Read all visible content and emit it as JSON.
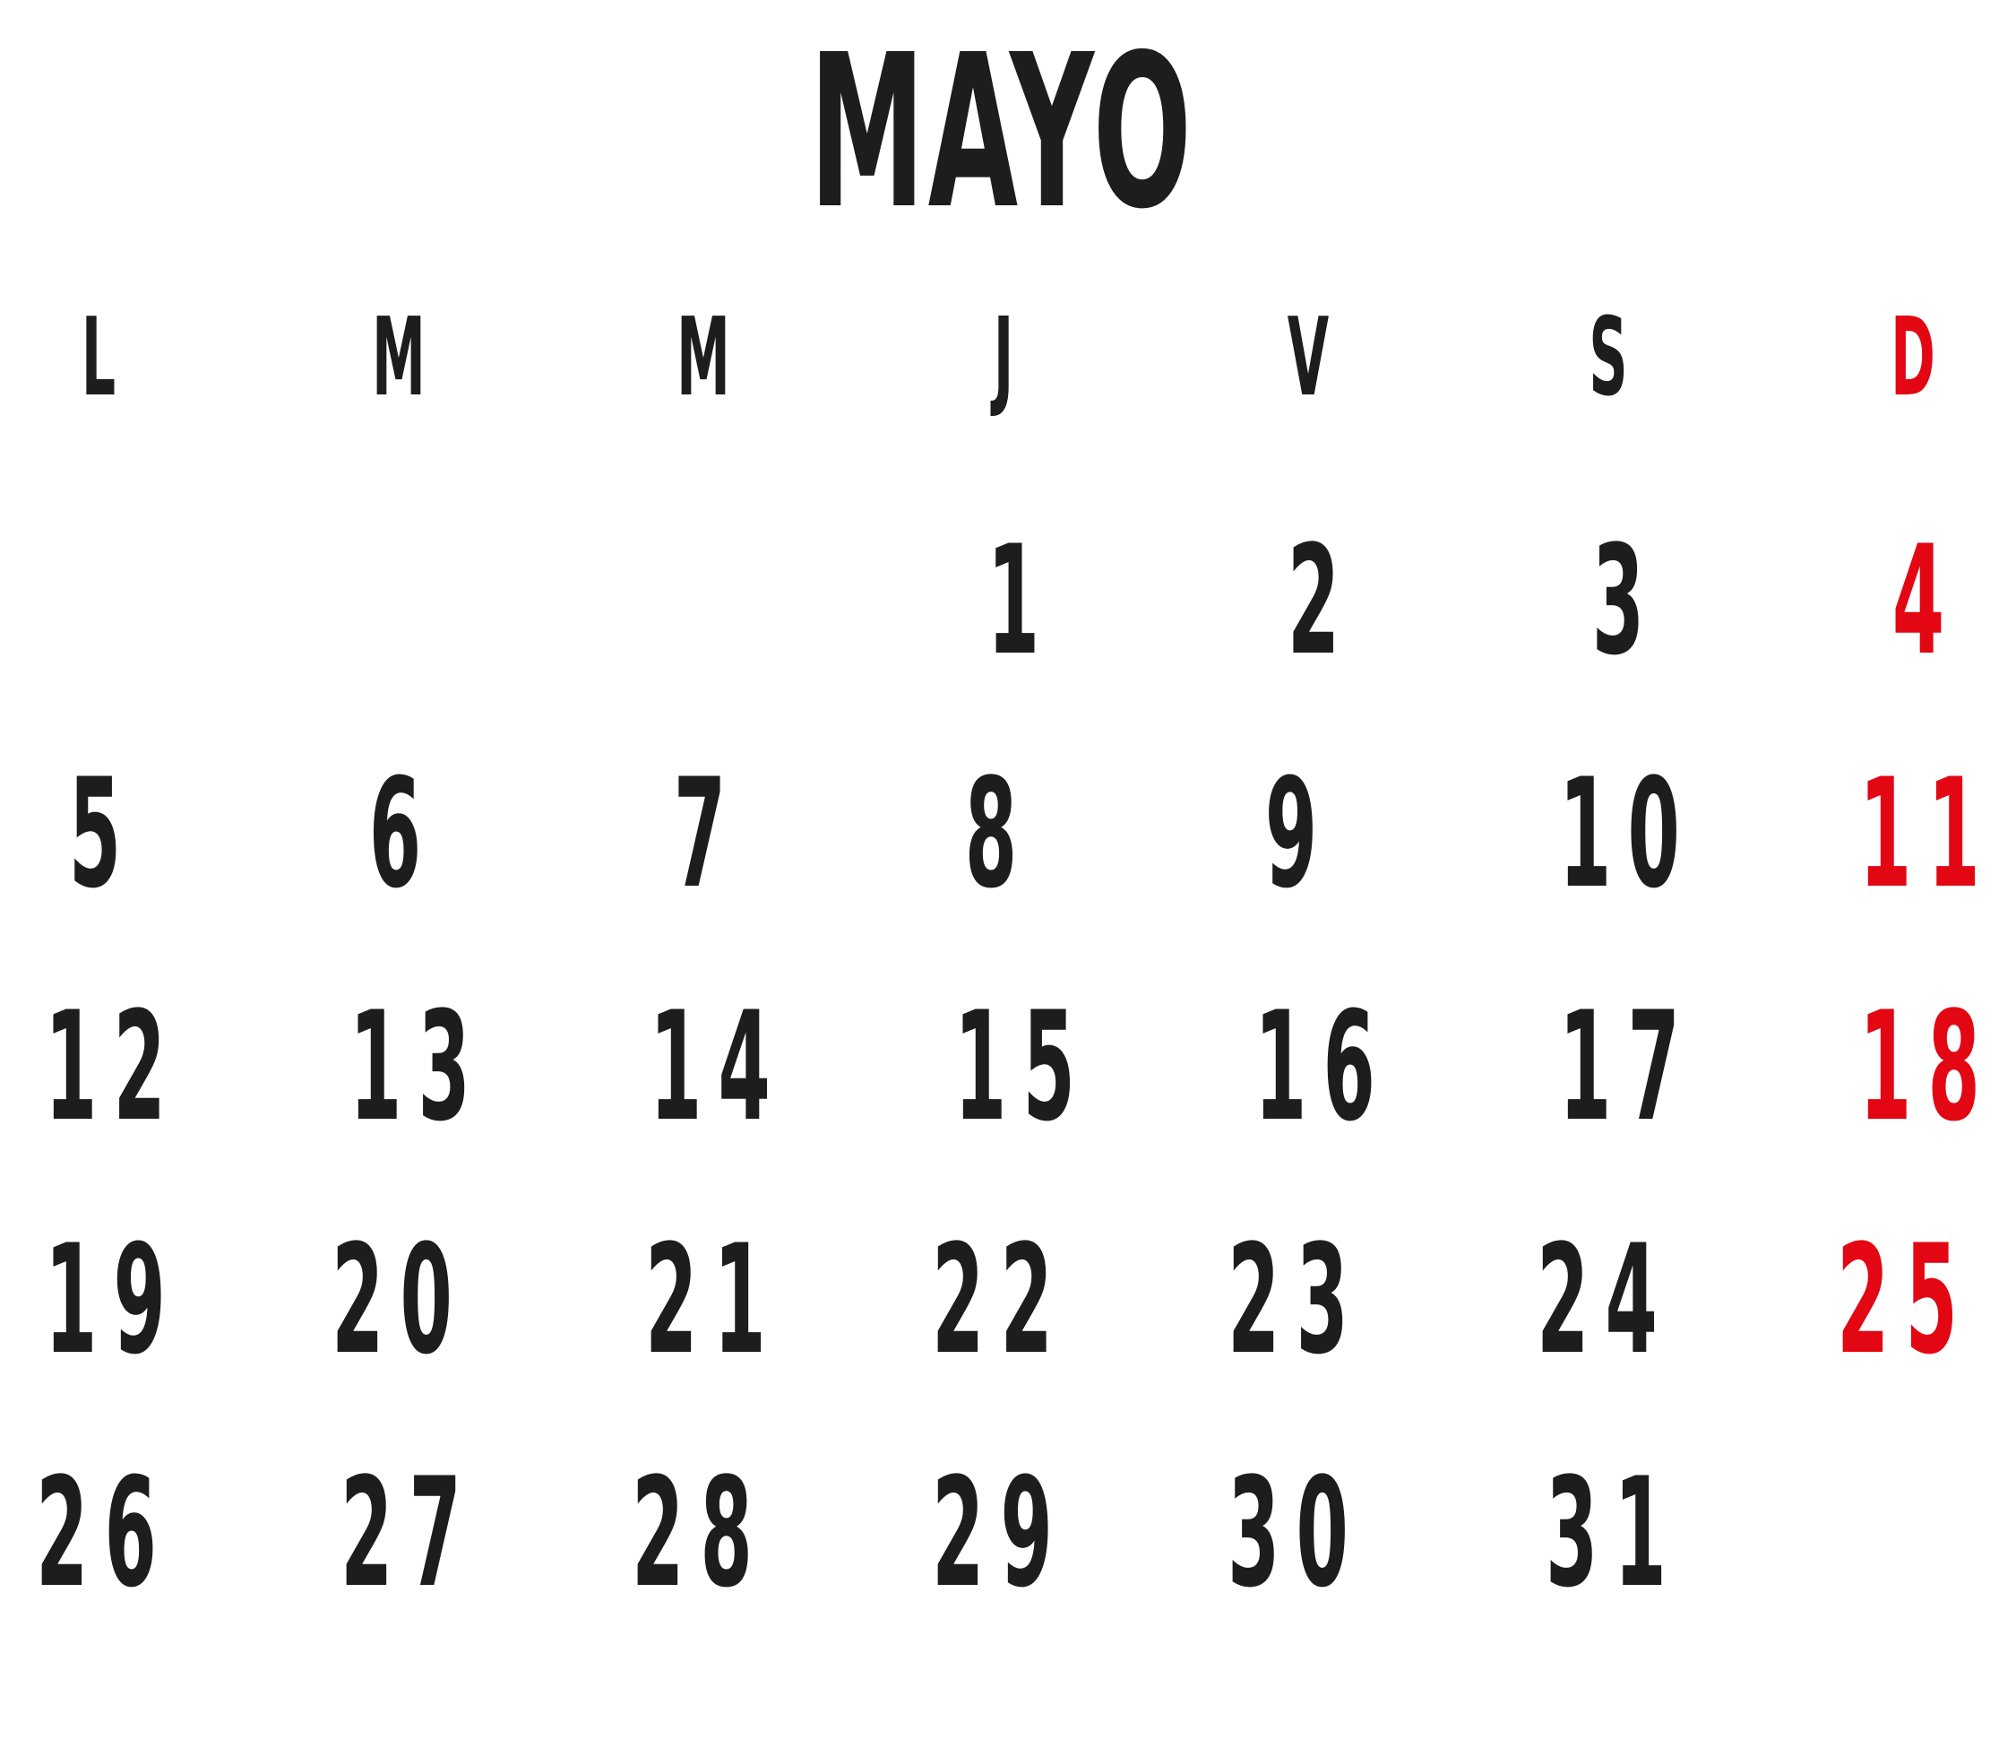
{
  "calendar": {
    "month": "MAYO",
    "weekdays": [
      "L",
      "M",
      "M",
      "J",
      "V",
      "S",
      "D"
    ],
    "sunday_color": "#e30613",
    "text_color": "#1d1d1b",
    "weeks": [
      [
        "",
        "",
        "",
        "1",
        "2",
        "3",
        "4"
      ],
      [
        "5",
        "6",
        "7",
        "8",
        "9",
        "10",
        "11"
      ],
      [
        "12",
        "13",
        "14",
        "15",
        "16",
        "17",
        "18"
      ],
      [
        "19",
        "20",
        "21",
        "22",
        "23",
        "24",
        "25"
      ],
      [
        "26",
        "27",
        "28",
        "29",
        "30",
        "31",
        ""
      ]
    ]
  }
}
